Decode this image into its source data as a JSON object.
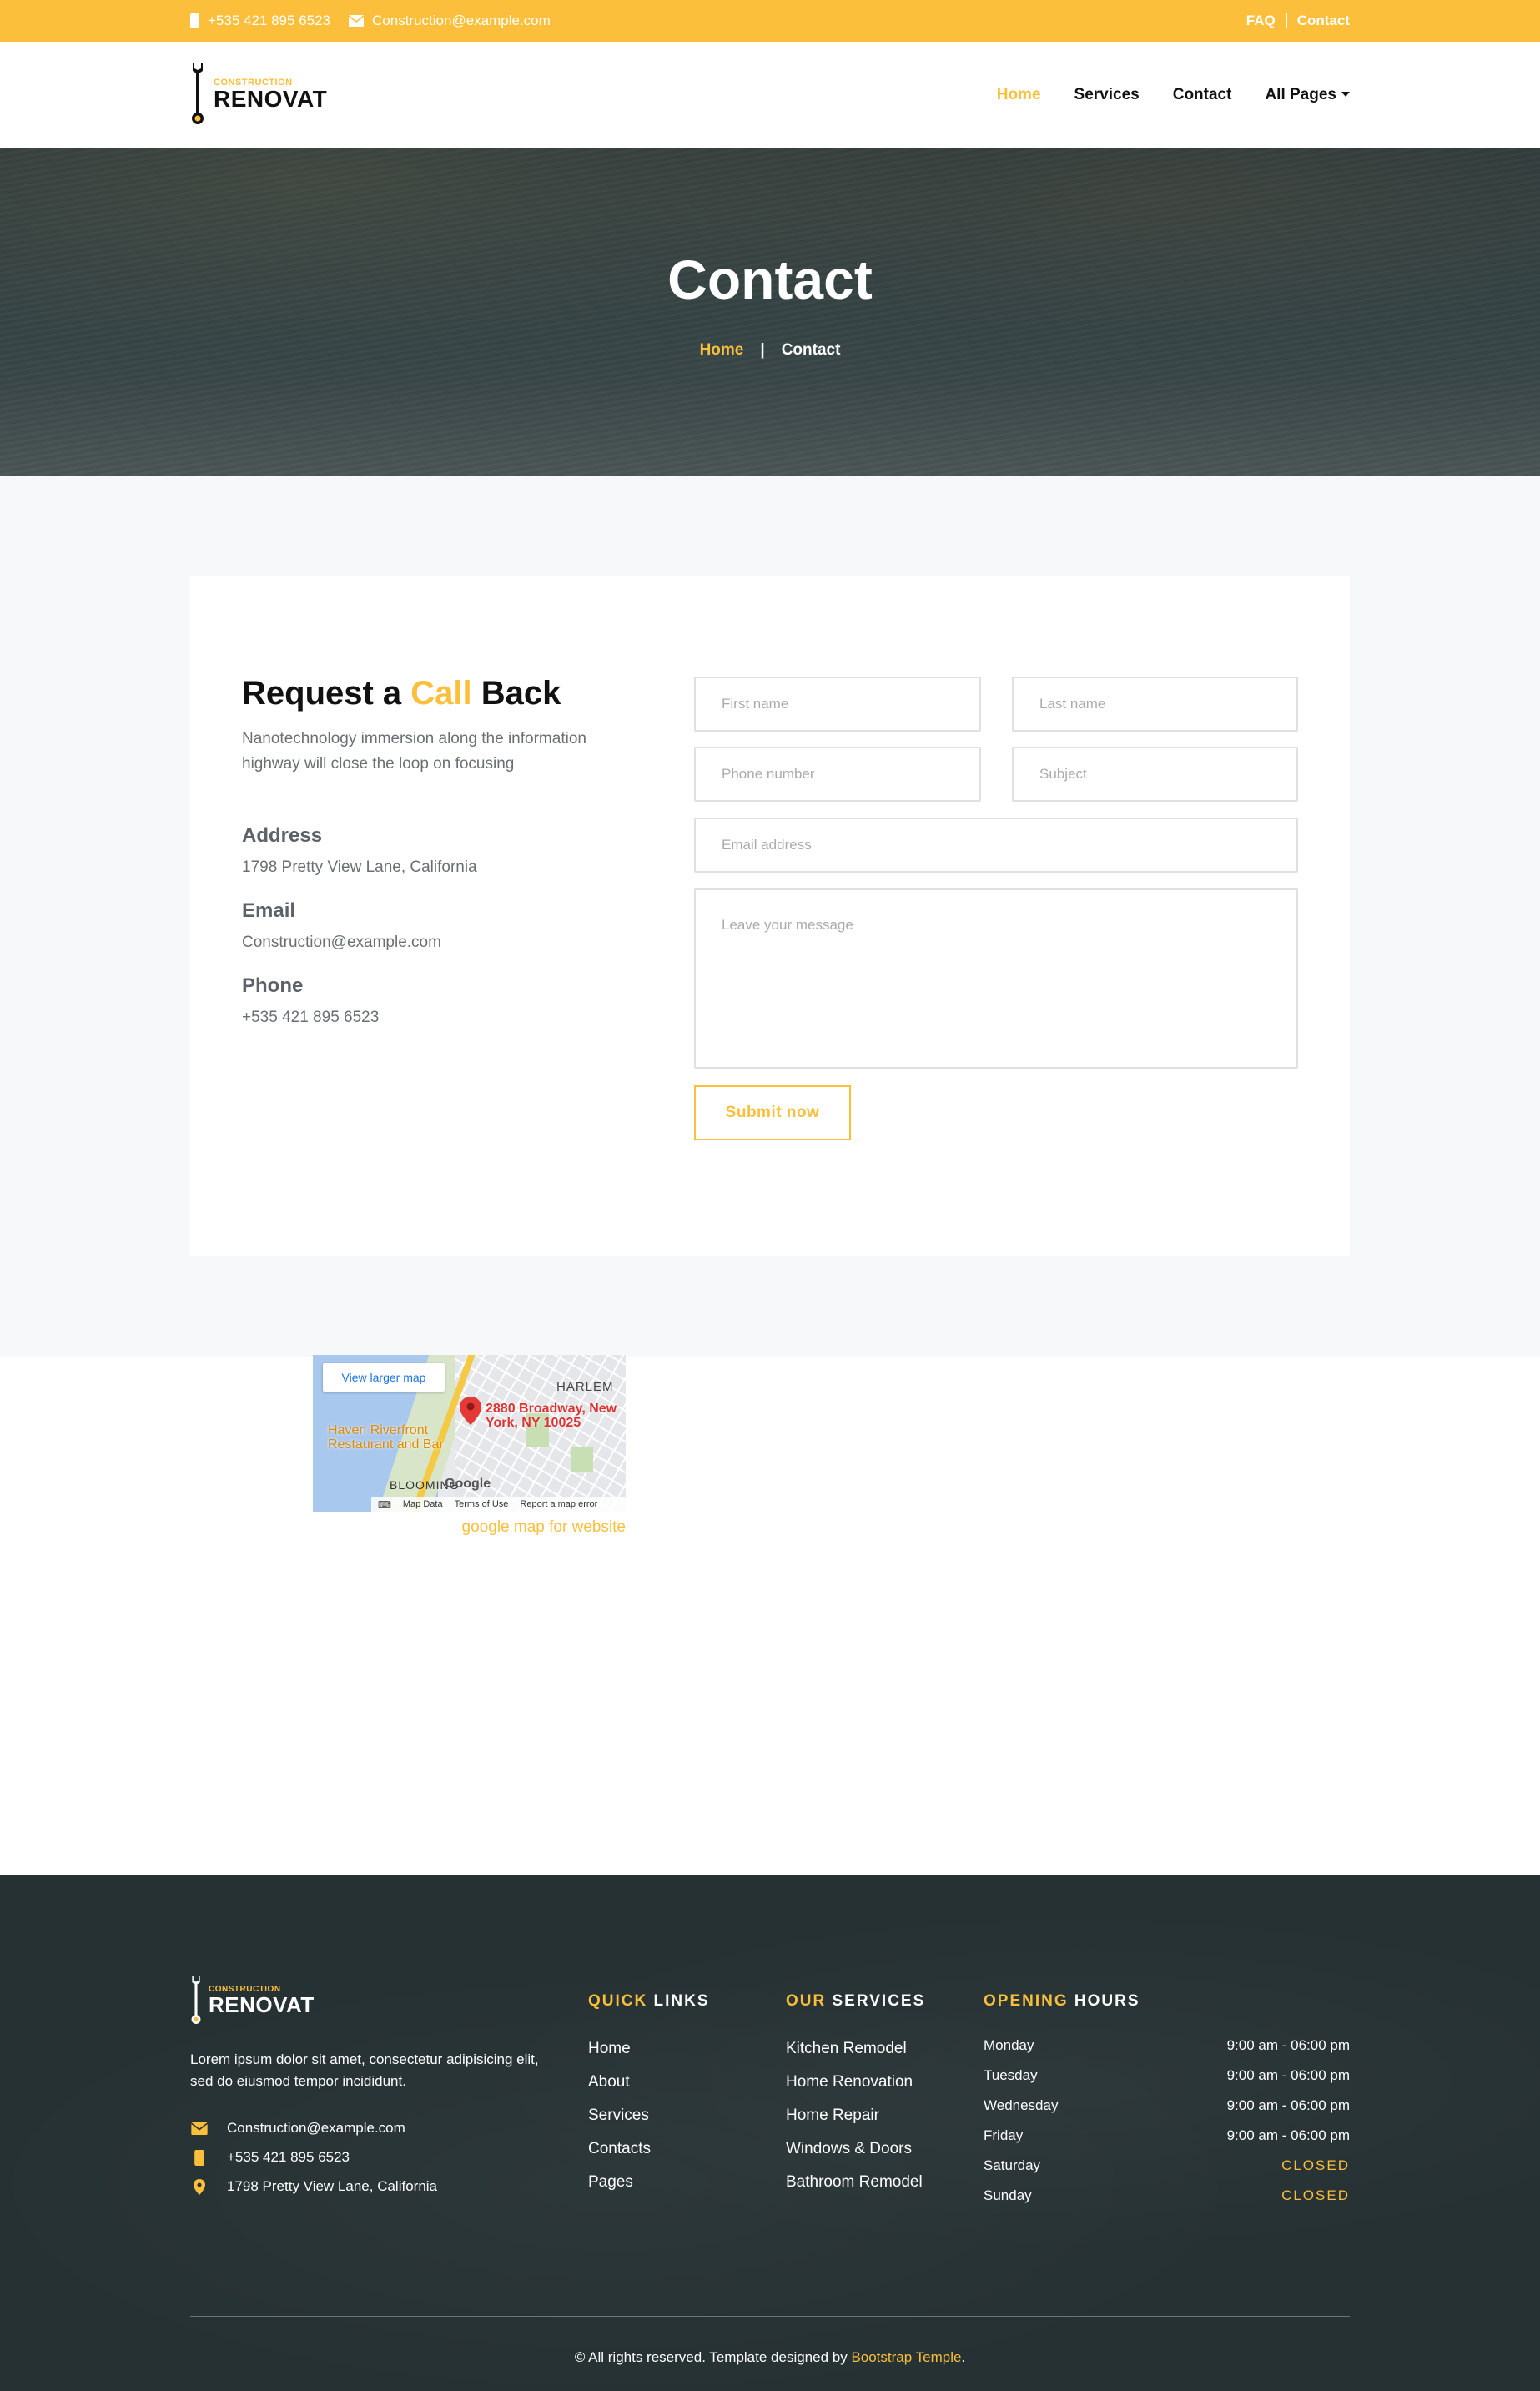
{
  "topbar": {
    "phone": "+535 421 895 6523",
    "email": "Construction@example.com",
    "links": [
      "FAQ",
      "Contact"
    ]
  },
  "brand": {
    "small": "CONSTRUCTION",
    "big": "RENOVAT"
  },
  "nav": {
    "items": [
      "Home",
      "Services",
      "Contact",
      "All Pages"
    ],
    "active": "Home"
  },
  "hero": {
    "title": "Contact",
    "breadcrumb": [
      "Home",
      "Contact"
    ]
  },
  "contact": {
    "title_pre": "Request a ",
    "title_accent": "Call",
    "title_post": " Back",
    "description": "Nanotechnology immersion along the information highway will close the loop on focusing",
    "address_label": "Address",
    "address": "1798 Pretty View Lane, California",
    "email_label": "Email",
    "email": "Construction@example.com",
    "phone_label": "Phone",
    "phone": "+535 421 895 6523"
  },
  "form": {
    "first_name": "First name",
    "last_name": "Last name",
    "phone": "Phone number",
    "subject": "Subject",
    "email": "Email address",
    "message": "Leave your message",
    "submit": "Submit now"
  },
  "map": {
    "view_larger": "View larger map",
    "address_line1": "2880 Broadway, New",
    "address_line2": "York, NY 10025",
    "poi_line1": "Haven Riverfront",
    "poi_line2": "Restaurant and Bar",
    "harlem": "HARLEM",
    "bloomingdale": "BLOOMING",
    "google": "Google",
    "map_data": "Map Data",
    "terms": "Terms of Use",
    "report": "Report a map error",
    "caption": "google map for website"
  },
  "footer": {
    "about": "Lorem ipsum dolor sit amet, consectetur adipisicing elit, sed do eiusmod tempor incididunt.",
    "email": "Construction@example.com",
    "phone": "+535 421 895 6523",
    "address": "1798 Pretty View Lane, California",
    "quick_links_accent": "QUICK",
    "quick_links_rest": " LINKS",
    "quick_links": [
      "Home",
      "About",
      "Services",
      "Contacts",
      "Pages"
    ],
    "services_accent": "OUR",
    "services_rest": " SERVICES",
    "services": [
      "Kitchen Remodel",
      "Home Renovation",
      "Home Repair",
      "Windows & Doors",
      "Bathroom Remodel"
    ],
    "hours_accent": "OPENING",
    "hours_rest": " HOURS",
    "hours": [
      {
        "day": "Monday",
        "time": "9:00 am - 06:00 pm"
      },
      {
        "day": "Tuesday",
        "time": "9:00 am - 06:00 pm"
      },
      {
        "day": "Wednesday",
        "time": "9:00 am - 06:00 pm"
      },
      {
        "day": "Friday",
        "time": "9:00 am - 06:00 pm"
      },
      {
        "day": "Saturday",
        "time": "CLOSED"
      },
      {
        "day": "Sunday",
        "time": "CLOSED"
      }
    ],
    "copyright_pre": "© All rights reserved. Template designed by ",
    "copyright_link": "Bootstrap Temple",
    "copyright_post": "."
  },
  "colors": {
    "accent": "#fbbf3b",
    "dark": "#263133",
    "text": "#111111"
  }
}
